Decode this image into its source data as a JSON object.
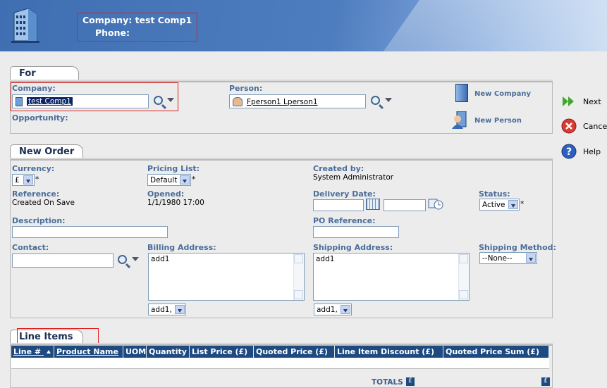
{
  "header": {
    "company_line": "Company: test Comp1",
    "phone_line": "Phone:",
    "icon": "building-icon"
  },
  "for_section": {
    "tab_label": "For",
    "company_label": "Company:",
    "company_value": "test Comp1",
    "person_label": "Person:",
    "person_value": "Fperson1 Lperson1",
    "opportunity_label": "Opportunity:",
    "new_company_label": "New Company",
    "new_person_label": "New Person"
  },
  "actions": {
    "next_label": "Next",
    "cancel_label": "Cancel",
    "help_label": "Help"
  },
  "order_section": {
    "tab_label": "New Order",
    "currency_label": "Currency:",
    "currency_value": "£",
    "pricing_label": "Pricing List:",
    "pricing_value": "Default",
    "created_by_label": "Created by:",
    "created_by_value": "System Administrator",
    "reference_label": "Reference:",
    "reference_value": "Created On Save",
    "opened_label": "Opened:",
    "opened_value": "1/1/1980 17:00",
    "delivery_label": "Delivery Date:",
    "status_label": "Status:",
    "status_value": "Active",
    "description_label": "Description:",
    "po_label": "PO Reference:",
    "contact_label": "Contact:",
    "billing_label": "Billing Address:",
    "billing_value": "add1",
    "billing_select": "add1,",
    "shipping_label": "Shipping Address:",
    "shipping_value": "add1",
    "shipping_select": "add1,",
    "ship_method_label": "Shipping Method:",
    "ship_method_value": "--None--",
    "required_mark": "*"
  },
  "line_items": {
    "tab_label": "Line Items",
    "columns": [
      "Line #",
      "Product Name",
      "UOM",
      "Quantity",
      "List Price (£)",
      "Quoted Price (£)",
      "Line Item Discount (£)",
      "Quoted Price Sum (£)"
    ],
    "totals_label": "TOTALS",
    "currency_badge": "£"
  },
  "colors": {
    "header_blue": "#4e7dbf",
    "label_blue": "#4a6d9a",
    "table_header": "#1d4a80",
    "highlight_red": "#e02020"
  }
}
